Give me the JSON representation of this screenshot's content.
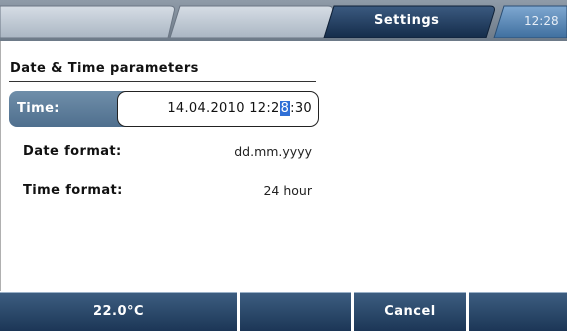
{
  "header": {
    "tab_title": "Settings",
    "clock": "12:28"
  },
  "section": {
    "title": "Date & Time parameters"
  },
  "time_field": {
    "label": "Time:",
    "value_before_cursor": "14.04.2010 12:2",
    "cursor_char": "8",
    "value_after_cursor": ":30"
  },
  "params": {
    "date_format_label": "Date format:",
    "date_format_value": "dd.mm.yyyy",
    "time_format_label": "Time format:",
    "time_format_value": "24 hour"
  },
  "softkeys": {
    "key1": "22.0°C",
    "key2": "",
    "key3": "Cancel",
    "key4": ""
  },
  "colors": {
    "accent": "#4f6f8e",
    "softkey": "#2a4668",
    "active_tab": "#1e3a5f",
    "cursor": "#2f6fd6"
  }
}
